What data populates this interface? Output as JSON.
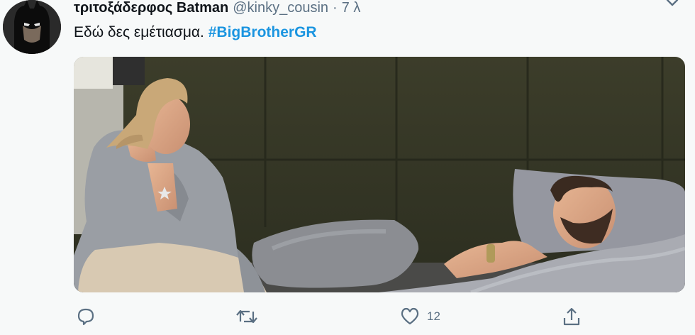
{
  "tweet": {
    "display_name": "τριτοξάδερφος Batman",
    "handle": "@kinky_cousin",
    "separator": "·",
    "time": "7 λ",
    "text": "Εδώ δες εμέτιασμα.",
    "hashtag": "#BigBrotherGR"
  },
  "actions": {
    "like_count": "12"
  },
  "icons": {
    "avatar": "batman-avatar",
    "caret": "chevron-down-icon",
    "reply": "reply-icon",
    "retweet": "retweet-icon",
    "like": "heart-icon",
    "share": "share-icon"
  },
  "colors": {
    "hashtag": "#1b95e0",
    "secondary_text": "#5b7083",
    "primary_text": "#0f1419"
  }
}
